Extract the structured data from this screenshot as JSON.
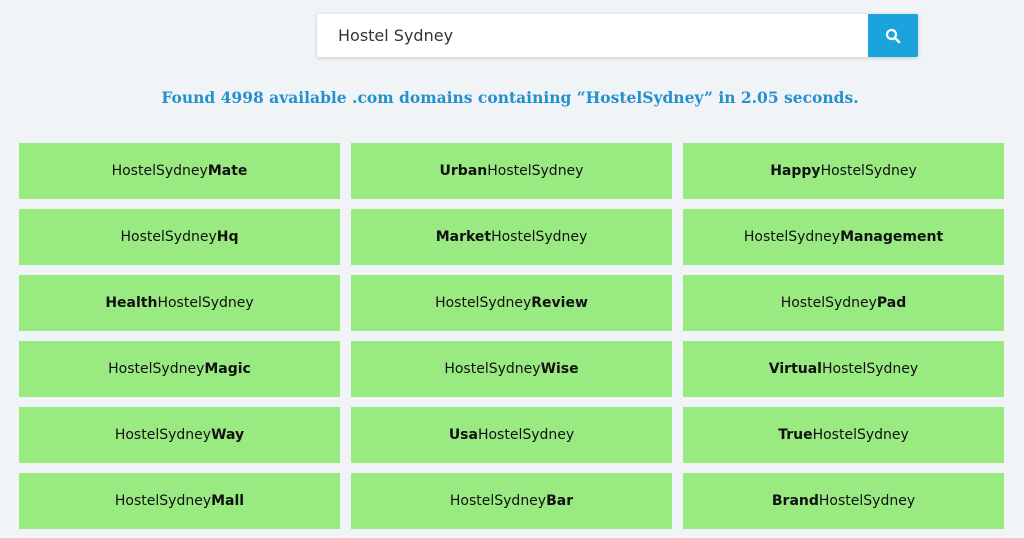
{
  "search": {
    "value": "Hostel Sydney",
    "button_icon": "search-icon"
  },
  "result_message": "Found 4998 available .com domains containing “HostelSydney” in 2.05 seconds.",
  "colors": {
    "accent": "#1aa3dd",
    "message": "#2390cf",
    "cell_bg": "#9aea82",
    "page_bg": "#f1f4f6"
  },
  "domains": [
    {
      "a": "HostelSydney",
      "b": "Mate",
      "bold_first": false
    },
    {
      "a": "Urban",
      "b": "HostelSydney",
      "bold_first": true
    },
    {
      "a": "Happy",
      "b": "HostelSydney",
      "bold_first": true
    },
    {
      "a": "HostelSydney",
      "b": "Hq",
      "bold_first": false
    },
    {
      "a": "Market",
      "b": "HostelSydney",
      "bold_first": true
    },
    {
      "a": "HostelSydney",
      "b": "Management",
      "bold_first": false
    },
    {
      "a": "Health",
      "b": "HostelSydney",
      "bold_first": true
    },
    {
      "a": "HostelSydney",
      "b": "Review",
      "bold_first": false
    },
    {
      "a": "HostelSydney",
      "b": "Pad",
      "bold_first": false
    },
    {
      "a": "HostelSydney",
      "b": "Magic",
      "bold_first": false
    },
    {
      "a": "HostelSydney",
      "b": "Wise",
      "bold_first": false
    },
    {
      "a": "Virtual",
      "b": "HostelSydney",
      "bold_first": true
    },
    {
      "a": "HostelSydney",
      "b": "Way",
      "bold_first": false
    },
    {
      "a": "Usa",
      "b": "HostelSydney",
      "bold_first": true
    },
    {
      "a": "True",
      "b": "HostelSydney",
      "bold_first": true
    },
    {
      "a": "HostelSydney",
      "b": "Mall",
      "bold_first": false
    },
    {
      "a": "HostelSydney",
      "b": "Bar",
      "bold_first": false
    },
    {
      "a": "Brand",
      "b": "HostelSydney",
      "bold_first": true
    }
  ]
}
